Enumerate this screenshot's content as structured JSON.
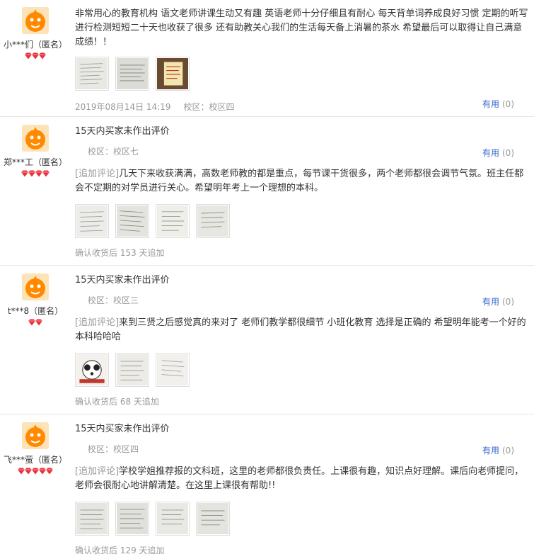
{
  "reviews": [
    {
      "username": "小***们（匿名）",
      "gems": 3,
      "content": "非常用心的教育机构 语文老师讲课生动又有趣 英语老师十分仔细且有耐心 每天背单词养成良好习惯 定期的听写进行检测短短二十天也收获了很多 还有助教关心我们的生活每天备上消暑的茶水 希望最后可以取得让自己满意成绩！！",
      "date": "2019年08月14日 14:19",
      "campus": "校区：校区四",
      "useful_label": "有用",
      "useful_count": "(0)"
    },
    {
      "username": "郑***工（匿名）",
      "gems": 4,
      "content": "15天内买家未作出评价",
      "campus": "校区：校区七",
      "useful_label": "有用",
      "useful_count": "(0)",
      "additional_label": "[追加评论]",
      "additional_text": "几天下来收获满满，高数老师教的都是重点，每节课干货很多，两个老师都很会调节气氛。班主任都会不定期的对学员进行关心。希望明年考上一个理想的本科。",
      "additional_info": "确认收货后 153 天追加"
    },
    {
      "username": "t***8（匿名）",
      "gems": 2,
      "content": "15天内买家未作出评价",
      "campus": "校区：校区三",
      "useful_label": "有用",
      "useful_count": "(0)",
      "additional_label": "[追加评论]",
      "additional_text": "来到三贤之后感觉真的来对了 老师们教学都很细节 小班化教育 选择是正确的 希望明年能考一个好的本科哈哈哈",
      "additional_info": "确认收货后 68 天追加"
    },
    {
      "username": "飞***萤（匿名）",
      "gems": 5,
      "content": "15天内买家未作出评价",
      "campus": "校区：校区四",
      "useful_label": "有用",
      "useful_count": "(0)",
      "additional_label": "[追加评论]",
      "additional_text": "学校学姐推荐报的文科班，这里的老师都很负责任。上课很有趣，知识点好理解。课后向老师提问，老师会很耐心地讲解清楚。在这里上课很有帮助!!",
      "additional_info": "确认收货后 129 天追加"
    }
  ]
}
